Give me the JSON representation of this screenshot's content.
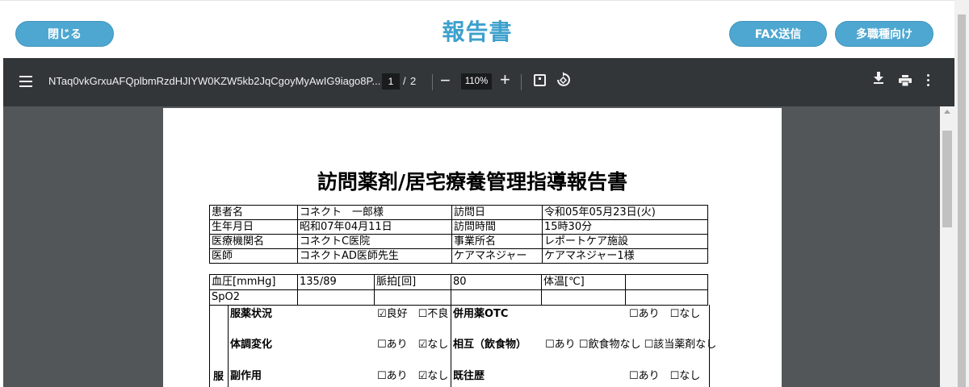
{
  "header": {
    "close_label": "閉じる",
    "title": "報告書",
    "fax_label": "FAX送信",
    "multi_label": "多職種向け"
  },
  "toolbar": {
    "filename": "NTaq0vkGrxuAFQplbmRzdHJIYW0KZW5kb2JqCgoyMyAwIG9iago8P...",
    "current_page": "1",
    "page_sep": "/",
    "total_pages": "2",
    "zoom_minus": "−",
    "zoom": "110%",
    "zoom_plus": "+",
    "icons": [
      "menu-icon",
      "fit-page-icon",
      "rotate-icon",
      "download-icon",
      "print-icon",
      "more-icon"
    ]
  },
  "document": {
    "title": "訪問薬剤/居宅療養管理指導報告書",
    "info_rows": [
      [
        "患者名",
        "コネクト　一郎様",
        "訪問日",
        "令和05年05月23日(火)"
      ],
      [
        "生年月日",
        "昭和07年04月11日",
        "訪問時間",
        "15時30分"
      ],
      [
        "医療機関名",
        "コネクトC医院",
        "事業所名",
        "レポートケア施設"
      ],
      [
        "医師",
        "コネクトAD医師先生",
        "ケアマネジャー",
        "ケアマネジャー1様"
      ]
    ],
    "vitals": {
      "bp_label": "血圧[mmHg]",
      "bp_value": "135/89",
      "pulse_label": "脈拍[回]",
      "pulse_value": "80",
      "temp_label": "体温[℃]",
      "temp_value": "",
      "spo2_label": "SpO2",
      "spo2_value": ""
    },
    "checks": {
      "section_label": "服",
      "rows": [
        {
          "label": "服薬状況",
          "options": "☑良好　☐不良",
          "right_label": "併用薬OTC",
          "right_options": "☐あり　☐なし"
        },
        {
          "label": "体調変化",
          "options": "☐あり　☑なし",
          "right_label": "相互（飲食物）",
          "right_options": "☐あり ☐飲食物なし ☐該当薬剤なし"
        },
        {
          "label": "副作用",
          "options": "☐あり　☑なし",
          "right_label": "既往歴",
          "right_options": "☐あり　☐なし"
        }
      ]
    }
  }
}
